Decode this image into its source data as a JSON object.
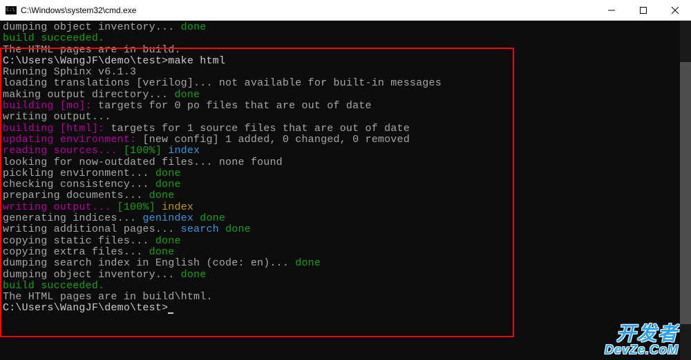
{
  "window": {
    "title": "C:\\Windows\\system32\\cmd.exe"
  },
  "terminal": {
    "line01a": "dumping object inventory... ",
    "line01b": "done",
    "line02": "build succeeded.",
    "line_blank": "",
    "line03": "The HTML pages are in build.",
    "line04a": "C:\\Users\\WangJF\\demo\\test>",
    "line04b": "make html",
    "line05": "Running Sphinx v6.1.3",
    "line06a": "loading translations [verilog]... ",
    "line06b": "not available for built-in messages",
    "line07a": "making output directory... ",
    "line07b": "done",
    "line08a": "building [mo]: ",
    "line08b": "targets for 0 po files that are out of date",
    "line09": "writing output... ",
    "line10a": "building [html]: ",
    "line10b": "targets for 1 source files that are out of date",
    "line11a": "updating environment: ",
    "line11b": "[new config] 1 added, 0 changed, 0 removed",
    "line12a": "reading sources... ",
    "line12b": "[100%] ",
    "line12c": "index",
    "line13a": "looking for now-outdated files... ",
    "line13b": "none found",
    "line14a": "pickling environment... ",
    "line14b": "done",
    "line15a": "checking consistency... ",
    "line15b": "done",
    "line16a": "preparing documents... ",
    "line16b": "done",
    "line17a": "writing output... ",
    "line17b": "[100%] ",
    "line17c": "index",
    "line18a": "generating indices... ",
    "line18b": "genindex ",
    "line18c": "done",
    "line19a": "writing additional pages... ",
    "line19b": "search ",
    "line19c": "done",
    "line20a": "copying static files... ",
    "line20b": "done",
    "line21a": "copying extra files... ",
    "line21b": "done",
    "line22a": "dumping search index in English (code: en)... ",
    "line22b": "done",
    "line23a": "dumping object inventory... ",
    "line23b": "done",
    "line24": "build succeeded.",
    "line25": "The HTML pages are in build\\html.",
    "prompt": "C:\\Users\\WangJF\\demo\\test>"
  },
  "watermark": {
    "cn": "开发者",
    "en": "DevZe.CoM"
  }
}
